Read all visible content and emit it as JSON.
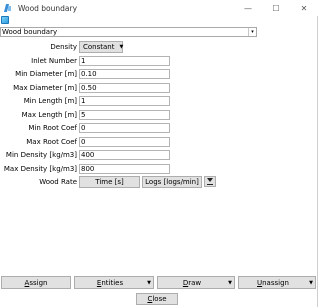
{
  "window": {
    "title": "Wood boundary",
    "controls": {
      "minimize": "—",
      "maximize": "☐",
      "close": "✕"
    }
  },
  "selector": {
    "value": "Wood boundary",
    "arrow": "▾"
  },
  "form": {
    "density": {
      "label": "Density",
      "value": "Constant",
      "arrow": "▼"
    },
    "rows": [
      {
        "label": "Inlet Number",
        "value": "1"
      },
      {
        "label": "Min Diameter [m]",
        "value": "0.10"
      },
      {
        "label": "Max Diameter [m]",
        "value": "0.50"
      },
      {
        "label": "Min Length [m]",
        "value": "1"
      },
      {
        "label": "Max Length [m]",
        "value": "5"
      },
      {
        "label": "Min Root Coef",
        "value": "0"
      },
      {
        "label": "Max Root Coef",
        "value": "0"
      },
      {
        "label": "Min Density [kg/m3]",
        "value": "400"
      },
      {
        "label": "Max Density [kg/m3]",
        "value": "800"
      }
    ],
    "wood_rate": {
      "label": "Wood Rate",
      "time_button": "Time [s]",
      "logs_button": "Logs [logs/min]"
    }
  },
  "bottom": {
    "assign": {
      "first": "A",
      "rest": "ssign"
    },
    "entities": {
      "first": "E",
      "rest": "ntities",
      "arrow": "▼"
    },
    "draw": {
      "first": "D",
      "rest": "raw",
      "arrow": "▼"
    },
    "unassign": {
      "first": "U",
      "rest": "nassign",
      "arrow": "▼"
    },
    "close": {
      "first": "C",
      "rest": "lose"
    }
  },
  "colors": {
    "button_face": "#e1e1e1",
    "border": "#adadad",
    "icon_blue": "#2e9de0"
  }
}
